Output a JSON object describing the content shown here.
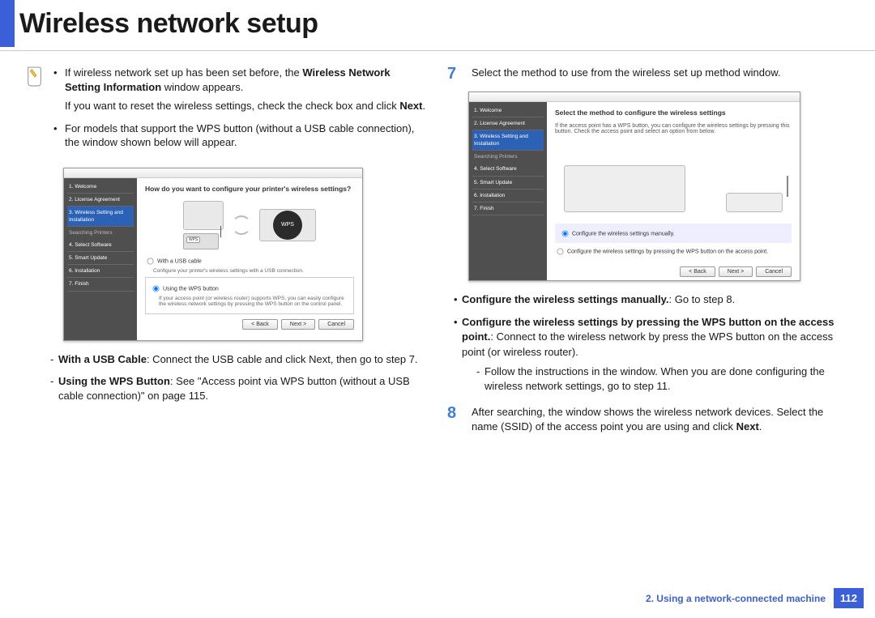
{
  "header": {
    "title": "Wireless network setup"
  },
  "left": {
    "note_bullet1_a": "If wireless network set up has been set before, the ",
    "note_bullet1_b": "Wireless Network Setting Information",
    "note_bullet1_c": " window appears.",
    "note_reset": "If you want to reset the wireless settings, check the check box and click ",
    "note_reset_bold": "Next",
    "note_bullet2": "For models that support the WPS button (without a USB cable connection), the window shown below will appear.",
    "ss1": {
      "heading": "How do you want to configure your printer's wireless settings?",
      "side": [
        "1. Welcome",
        "2. License Agreement",
        "3. Wireless Setting and Installation",
        "   Searching Printers",
        "4. Select Software",
        "5. Smart Update",
        "6. Installation",
        "7. Finish"
      ],
      "radio1_label": "With a USB cable",
      "radio1_desc": "Configure your printer's wireless settings with a USB connection.",
      "radio2_label": "Using the WPS button",
      "radio2_desc": "If your access point (or wireless router) supports WPS, you can easily configure the wireless network settings by pressing the WPS button on the control panel.",
      "btn_back": "< Back",
      "btn_next": "Next >",
      "btn_cancel": "Cancel",
      "wps": "WPS"
    },
    "dash1_bold": "With a USB Cable",
    "dash1_rest": ": Connect the USB cable and click Next, then go to step 7.",
    "dash2_bold": "Using the WPS Button",
    "dash2_rest": ": See \"Access point via WPS button (without a USB cable connection)\" on page 115."
  },
  "right": {
    "step7_num": "7",
    "step7_text": "Select the method to use from the wireless set up method window.",
    "ss2": {
      "heading": "Select the method to configure the wireless settings",
      "sub": "If the access point has a WPS button, you can configure the wireless settings by pressing this button. Check the access point and select an option from below.",
      "side": [
        "1. Welcome",
        "2. License Agreement",
        "3. Wireless Setting and Installation",
        "   Searching Printers",
        "4. Select Software",
        "5. Smart Update",
        "6. Installation",
        "7. Finish"
      ],
      "radio1_label": "Configure the wireless settings manually.",
      "radio2_label": "Configure the wireless settings by pressing the WPS button on the access point.",
      "btn_back": "< Back",
      "btn_next": "Next >",
      "btn_cancel": "Cancel"
    },
    "opt1_bold": "Configure the wireless settings manually.",
    "opt1_rest": ": Go to step 8.",
    "opt2_bold": "Configure the wireless settings by pressing the WPS button on the access point.",
    "opt2_rest": ": Connect to the wireless network by press the WPS button on the access point (or wireless router).",
    "opt2_dash": "Follow the instructions in the window. When you are done configuring the wireless network settings, go to step 11.",
    "step8_num": "8",
    "step8_text_a": "After searching, the window shows the wireless network devices. Select the name (SSID) of the access point you are using and click ",
    "step8_text_bold": "Next",
    "step8_text_b": "."
  },
  "footer": {
    "chapter": "2.  Using a network-connected machine",
    "page": "112"
  }
}
